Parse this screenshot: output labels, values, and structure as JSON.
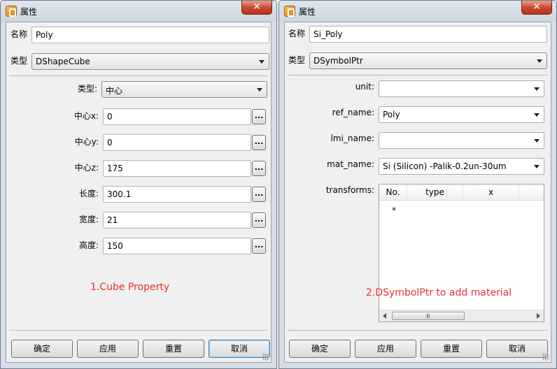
{
  "window1": {
    "title": "属性",
    "close_glyph": "✕",
    "name_label": "名称",
    "name_value": "Poly",
    "type_label": "类型",
    "type_value": "DShapeCube",
    "props": {
      "subtype_label": "类型:",
      "subtype_value": "中心",
      "centerx_label": "中心x:",
      "centerx_value": "0",
      "centery_label": "中心y:",
      "centery_value": "0",
      "centerz_label": "中心z:",
      "centerz_value": "175",
      "length_label": "长度:",
      "length_value": "300.1",
      "width_label": "宽度:",
      "width_value": "21",
      "height_label": "高度:",
      "height_value": "150",
      "ellipsis": "..."
    },
    "annotation": "1.Cube Property",
    "buttons": {
      "ok": "确定",
      "apply": "应用",
      "reset": "重置",
      "cancel": "取消"
    }
  },
  "window2": {
    "title": "属性",
    "close_glyph": "✕",
    "name_label": "名称",
    "name_value": "Si_Poly",
    "type_label": "类型",
    "type_value": "DSymbolPtr",
    "props": {
      "unit_label": "unit:",
      "unit_value": "",
      "ref_name_label": "ref_name:",
      "ref_name_value": "Poly",
      "lmi_name_label": "lmi_name:",
      "lmi_name_value": "",
      "mat_name_label": "mat_name:",
      "mat_name_value": "Si (Silicon) -Palik-0.2un-30um",
      "transforms_label": "transforms:"
    },
    "table": {
      "columns": [
        "No.",
        "type",
        "x"
      ],
      "new_row_marker": "*",
      "scroll_grip": "Ⅲ"
    },
    "annotation": "2.DSymbolPtr to add material",
    "buttons": {
      "ok": "确定",
      "apply": "应用",
      "reset": "重置",
      "cancel": "取消"
    }
  },
  "colors": {
    "annotation": "#e8322e",
    "close_button": "#c7452c",
    "window_frame": "#d6dde6",
    "client_bg": "#f0f0f0"
  }
}
